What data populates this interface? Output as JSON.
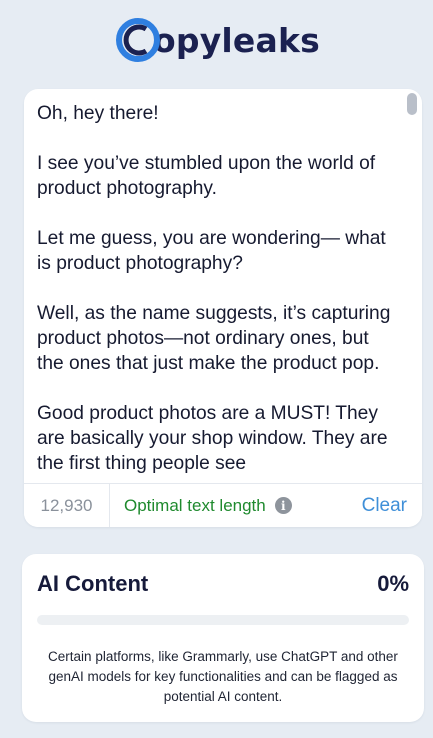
{
  "brand": {
    "name": "Copyleaks",
    "logo_text": "opyleaks",
    "logo_letter": "C",
    "ring_color": "#2f7fe0",
    "text_color": "#1b2150"
  },
  "editor": {
    "paragraphs": [
      "Oh, hey there!",
      "I see you’ve stumbled upon the world of product photography.",
      "Let me guess, you are wondering— what is product photography?",
      "Well, as the name suggests, it’s capturing product photos—not ordinary ones, but the ones that just make the product pop.",
      "Good product photos are a MUST! They are basically your shop window. They are the first thing people see"
    ],
    "char_count": "12,930",
    "length_status": "Optimal text length",
    "length_status_color": "#1f8a2e",
    "info_icon": "info-circle-icon",
    "clear_label": "Clear",
    "clear_color": "#3f8fd8"
  },
  "ai_content": {
    "title": "AI Content",
    "percent_label": "0%",
    "percent_value": 0,
    "bar_color": "#2b3a8c",
    "note": "Certain platforms, like Grammarly, use ChatGPT and other genAI models for key functionalities and can be flagged as potential AI content."
  }
}
